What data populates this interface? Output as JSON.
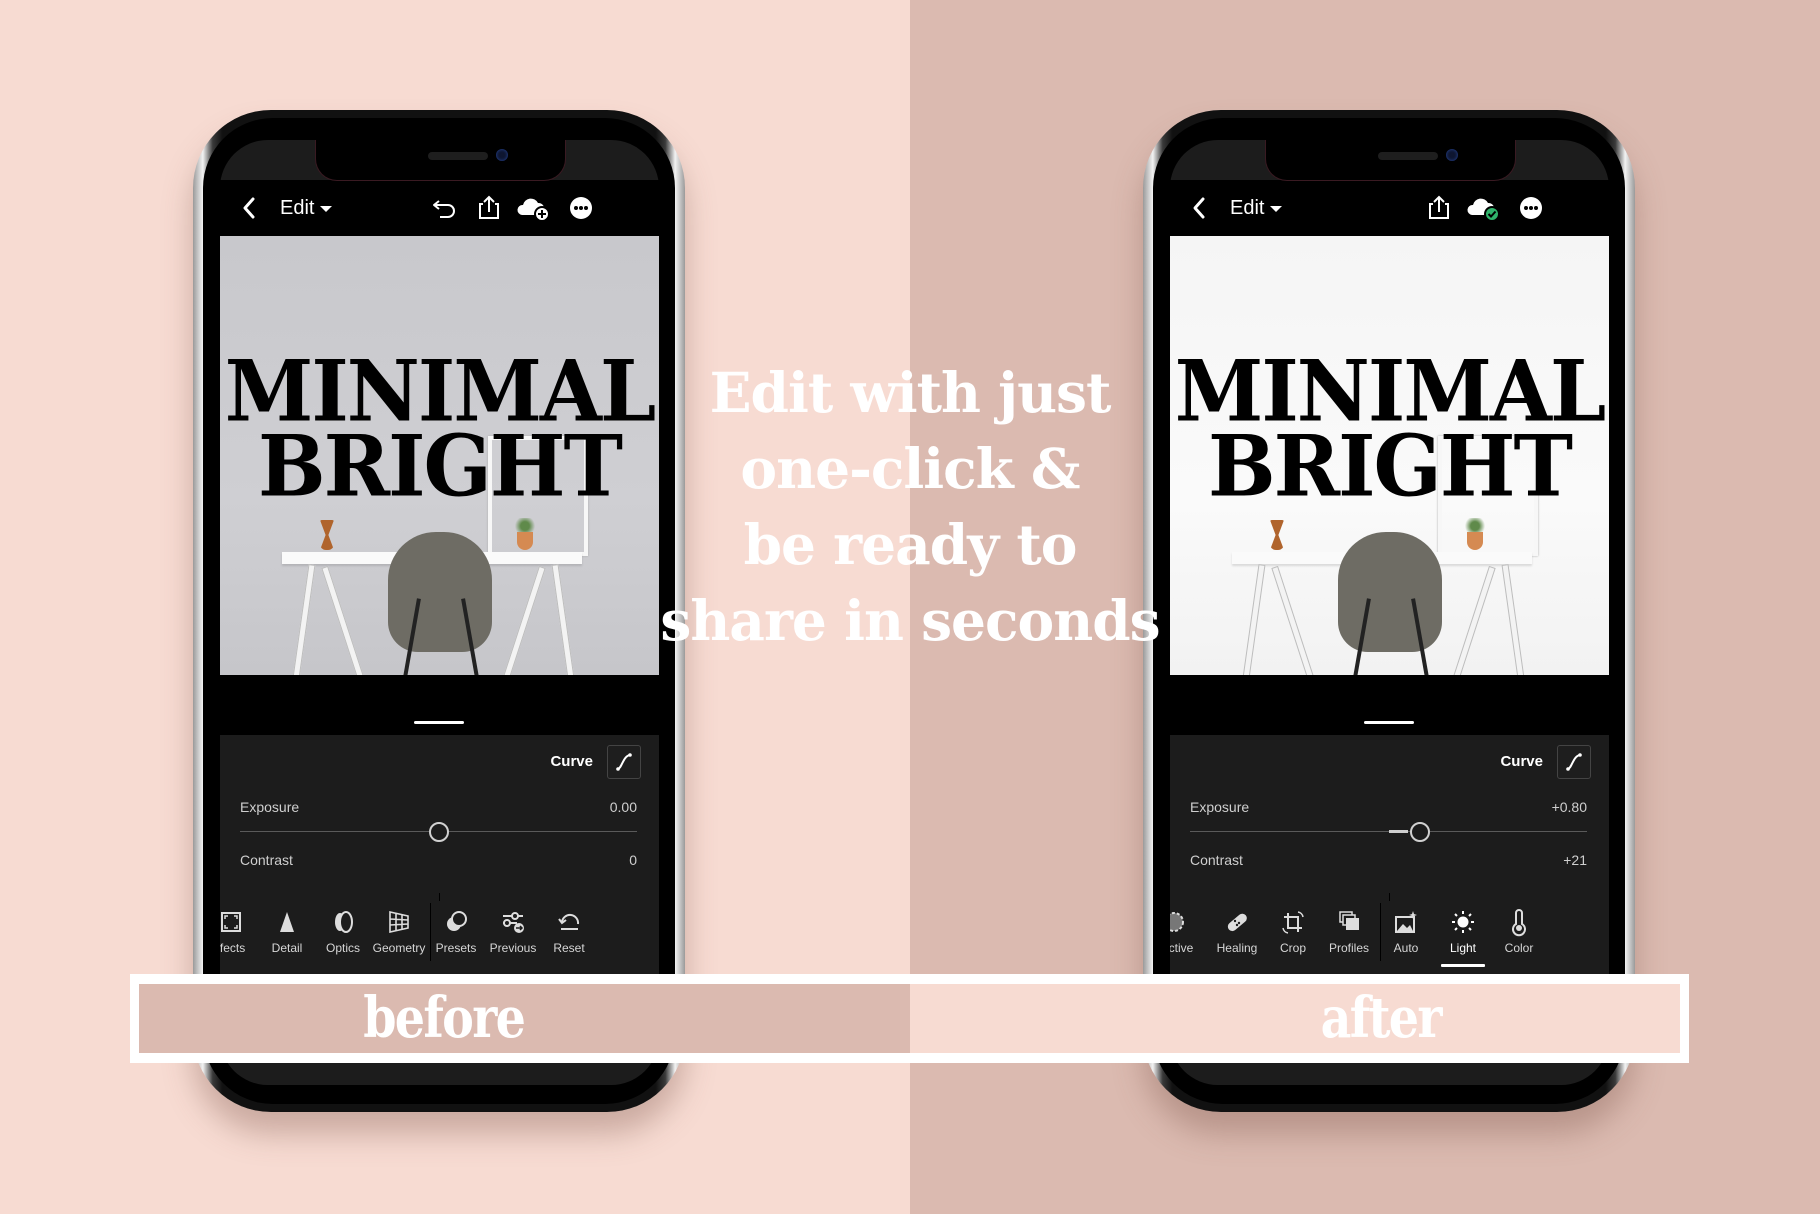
{
  "background": {
    "left_color": "#f7dbd2",
    "right_color": "#dbbab0"
  },
  "headline": {
    "lines": [
      "Edit with just",
      "one-click &",
      "be ready to",
      "share in seconds"
    ]
  },
  "banner": {
    "before_label": "before",
    "after_label": "after"
  },
  "phones": [
    {
      "state": "before",
      "appbar": {
        "back_icon": "chevron-left-icon",
        "title": "Edit",
        "icons": [
          "undo-icon",
          "share-icon",
          "cloud-add-icon",
          "more-icon"
        ]
      },
      "photo": {
        "title_line1": "MINIMAL",
        "title_line2": "BRIGHT"
      },
      "panel": {
        "curve_label": "Curve",
        "exposure": {
          "label": "Exposure",
          "value": "0.00",
          "slider_fraction": 0.5
        },
        "contrast": {
          "label": "Contrast",
          "value": "0"
        }
      },
      "toolbar": [
        {
          "label": "ffects",
          "icon": "effects-icon"
        },
        {
          "label": "Detail",
          "icon": "detail-icon"
        },
        {
          "label": "Optics",
          "icon": "optics-icon"
        },
        {
          "label": "Geometry",
          "icon": "geometry-icon"
        },
        {
          "label": "Presets",
          "icon": "presets-icon"
        },
        {
          "label": "Previous",
          "icon": "previous-icon"
        },
        {
          "label": "Reset",
          "icon": "reset-icon"
        }
      ]
    },
    {
      "state": "after",
      "appbar": {
        "back_icon": "chevron-left-icon",
        "title": "Edit",
        "icons": [
          "share-icon",
          "cloud-synced-icon",
          "more-icon"
        ],
        "sync_color": "#2fb36b"
      },
      "photo": {
        "title_line1": "MINIMAL",
        "title_line2": "BRIGHT"
      },
      "panel": {
        "curve_label": "Curve",
        "exposure": {
          "label": "Exposure",
          "value": "+0.80",
          "slider_fraction": 0.58
        },
        "contrast": {
          "label": "Contrast",
          "value": "+21"
        }
      },
      "toolbar": [
        {
          "label": "ctive",
          "icon": "selective-icon"
        },
        {
          "label": "Healing",
          "icon": "healing-icon"
        },
        {
          "label": "Crop",
          "icon": "crop-icon"
        },
        {
          "label": "Profiles",
          "icon": "profiles-icon"
        },
        {
          "label": "Auto",
          "icon": "auto-icon"
        },
        {
          "label": "Light",
          "icon": "light-icon",
          "active": true
        },
        {
          "label": "Color",
          "icon": "color-icon"
        }
      ]
    }
  ]
}
